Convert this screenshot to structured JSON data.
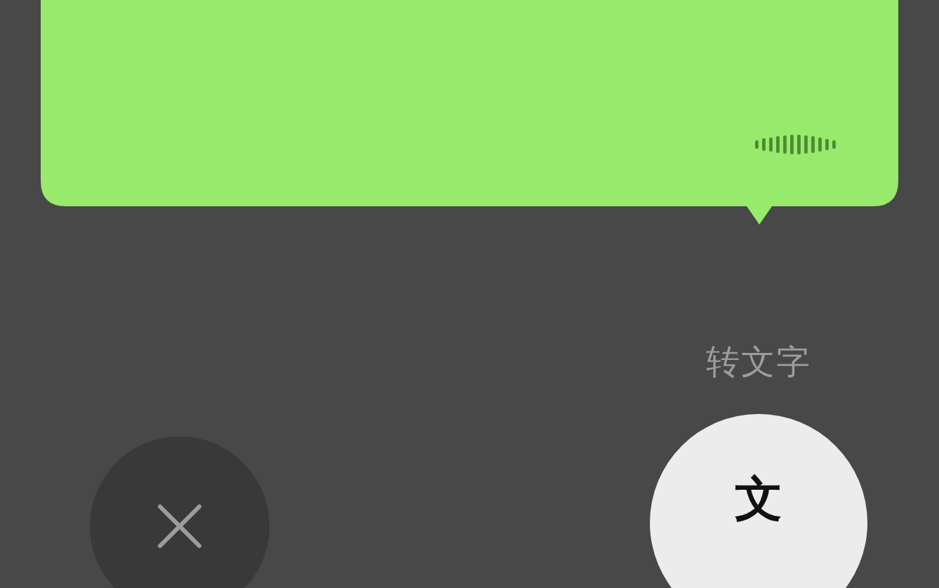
{
  "convert_label": "转文字",
  "convert_button": {
    "label": "文"
  }
}
